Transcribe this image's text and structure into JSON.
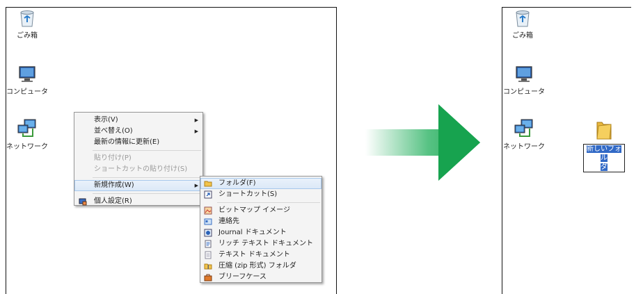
{
  "desktop_icons": {
    "recycle_bin": "ごみ箱",
    "computer": "コンピュータ",
    "network": "ネットワーク"
  },
  "context_menu": {
    "view": "表示(V)",
    "sort": "並べ替え(O)",
    "refresh": "最新の情報に更新(E)",
    "paste": "貼り付け(P)",
    "paste_shortcut": "ショートカットの貼り付け(S)",
    "new": "新規作成(W)",
    "personalize": "個人設定(R)"
  },
  "new_submenu": {
    "folder": "フォルダ(F)",
    "shortcut": "ショートカット(S)",
    "bitmap": "ビットマップ イメージ",
    "contact": "連絡先",
    "journal": "Journal ドキュメント",
    "rich_text": "リッチ テキスト ドキュメント",
    "text": "テキスト ドキュメント",
    "zip": "圧縮 (zip 形式) フォルダ",
    "briefcase": "ブリーフケース"
  },
  "result": {
    "new_folder_line1": "新しいフォル",
    "new_folder_line2": "ダ"
  },
  "colors": {
    "arrow_green": "#1fae5a",
    "selection_blue": "#3169c6",
    "folder_yellow": "#f2c44c"
  }
}
